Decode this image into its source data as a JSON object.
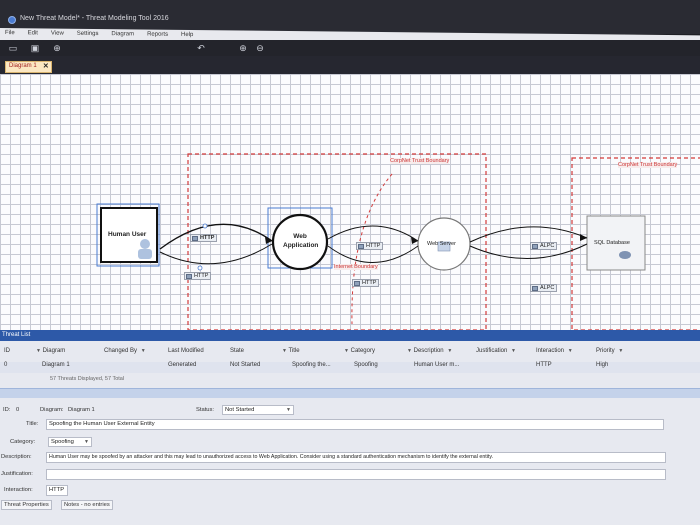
{
  "window": {
    "title": "New Threat Model* - Threat Modeling Tool 2016"
  },
  "menu": [
    "File",
    "Edit",
    "View",
    "Settings",
    "Diagram",
    "Reports",
    "Help"
  ],
  "doc_tab": {
    "label": "Diagram 1",
    "close": "✕"
  },
  "diagram": {
    "boundaries": [
      "CorpNet Trust Boundary",
      "CorpNet Trust Boundary",
      "Internet Boundary"
    ],
    "nodes": {
      "human_user": "Human User",
      "web_app": "Web Application",
      "web_server": "Web Server",
      "sql_db": "SQL Database"
    },
    "flows": [
      "HTTP",
      "HTTP",
      "HTTP",
      "HTTP",
      "ALPC",
      "ALPC"
    ]
  },
  "threat_list": {
    "header": "Threat List",
    "columns": [
      "ID",
      "Diagram",
      "Changed By",
      "Last Modified",
      "State",
      "Title",
      "Category",
      "Description",
      "Justification",
      "Interaction",
      "Priority"
    ],
    "row": {
      "id": "0",
      "diagram": "Diagram 1",
      "changed_by": "",
      "last_modified": "Generated",
      "state": "Not Started",
      "title": "Spoofing the...",
      "category": "Spoofing",
      "description": "Human User m...",
      "justification": "",
      "interaction": "HTTP",
      "priority": "High"
    },
    "summary": "57 Threats Displayed, 57 Total"
  },
  "details": {
    "id_label": "ID:",
    "id_value": "0",
    "diagram_label": "Diagram:",
    "diagram_value": "Diagram 1",
    "status_label": "Status:",
    "status_value": "Not Started",
    "title_label": "Title:",
    "title_value": "Spoofing the Human User External Entity",
    "category_label": "Category:",
    "category_value": "Spoofing",
    "description_label": "Description:",
    "description_value": "Human User may be spoofed by an attacker and this may lead to unauthorized access to Web Application. Consider using a standard authentication mechanism to identify the external entity.",
    "justification_label": "Justification:",
    "justification_value": "",
    "interaction_label": "Interaction:",
    "interaction_value": "HTTP"
  },
  "bottom_tabs": [
    "Threat Properties",
    "Notes - no entries"
  ],
  "colors": {
    "boundary": "#d23a3a",
    "selection": "#4a7bd1",
    "header": "#2d59a8"
  }
}
